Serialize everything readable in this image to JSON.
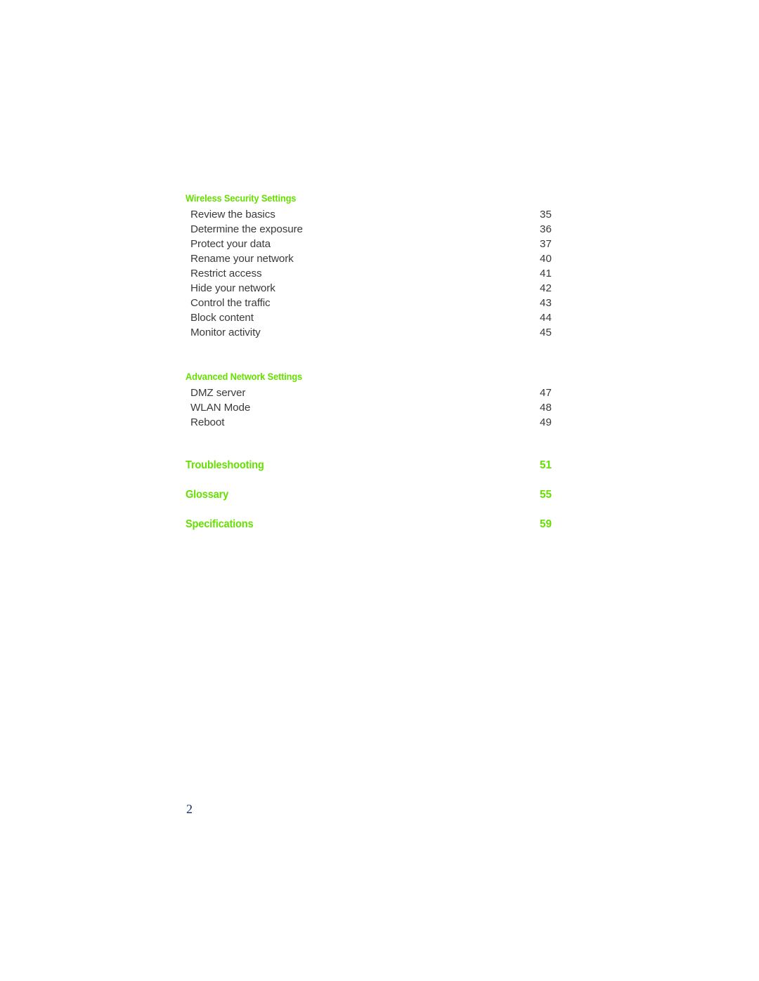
{
  "document": {
    "page_number": "2",
    "colors": {
      "accent_green": "#66e000",
      "body_text": "#3a3a3a",
      "folio_navy": "#1a2a6e",
      "background": "#ffffff"
    }
  },
  "toc": {
    "sections": [
      {
        "heading": "Wireless Security Settings",
        "entries": [
          {
            "label": "Review the basics",
            "page": "35"
          },
          {
            "label": "Determine the exposure",
            "page": "36"
          },
          {
            "label": "Protect your data",
            "page": "37"
          },
          {
            "label": "Rename your network",
            "page": "40"
          },
          {
            "label": "Restrict access",
            "page": "41"
          },
          {
            "label": "Hide your network",
            "page": "42"
          },
          {
            "label": "Control the traffic",
            "page": "43"
          },
          {
            "label": "Block content",
            "page": "44"
          },
          {
            "label": "Monitor activity",
            "page": "45"
          }
        ]
      },
      {
        "heading": "Advanced Network Settings",
        "entries": [
          {
            "label": "DMZ server",
            "page": "47"
          },
          {
            "label": "WLAN Mode",
            "page": "48"
          },
          {
            "label": "Reboot",
            "page": "49"
          }
        ]
      }
    ],
    "major_entries": [
      {
        "label": "Troubleshooting",
        "page": "51"
      },
      {
        "label": "Glossary",
        "page": "55"
      },
      {
        "label": "Specifications",
        "page": "59"
      }
    ]
  }
}
